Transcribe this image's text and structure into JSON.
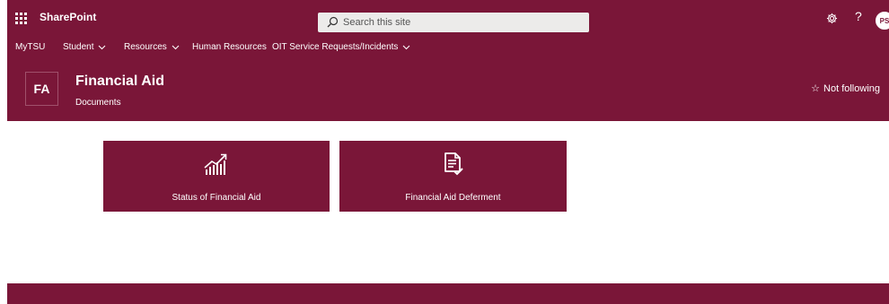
{
  "colors": {
    "brand": "#7a1638",
    "background": "#ffffff",
    "search_bg": "#ecebea"
  },
  "suitebar": {
    "app_name": "SharePoint",
    "search_placeholder": "Search this site",
    "help_label": "?",
    "avatar_initials": "PS"
  },
  "nav": {
    "items": [
      {
        "label": "MyTSU",
        "has_dropdown": false
      },
      {
        "label": "Student",
        "has_dropdown": true
      },
      {
        "label": "Resources",
        "has_dropdown": true
      },
      {
        "label": "Human Resources",
        "has_dropdown": false
      },
      {
        "label": "OIT Service Requests/Incidents",
        "has_dropdown": true
      }
    ]
  },
  "site": {
    "logo_initials": "FA",
    "title": "Financial Aid",
    "subtitle": "Documents",
    "follow_label": "Not following",
    "follow_icon": "star-outline-icon"
  },
  "tiles": [
    {
      "label": "Status of Financial Aid",
      "icon": "growth-chart-icon"
    },
    {
      "label": "Financial Aid Deferment",
      "icon": "document-check-icon"
    }
  ]
}
